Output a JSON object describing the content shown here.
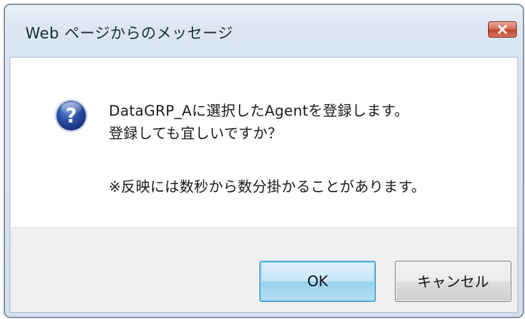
{
  "dialog": {
    "title": "Web ページからのメッセージ",
    "icon": "question-icon",
    "message_lines": [
      "DataGRP_Aに選択したAgentを登録します。",
      "登録しても宜しいですか？",
      "※反映には数秒から数分掛かることがあります。"
    ],
    "buttons": {
      "ok": "OK",
      "cancel": "キャンセル"
    }
  },
  "colors": {
    "title_frame": "#d3e0ee",
    "close_button": "#c7503a",
    "ok_button_border": "#3c7fb1",
    "footer": "#f0f0f0"
  }
}
